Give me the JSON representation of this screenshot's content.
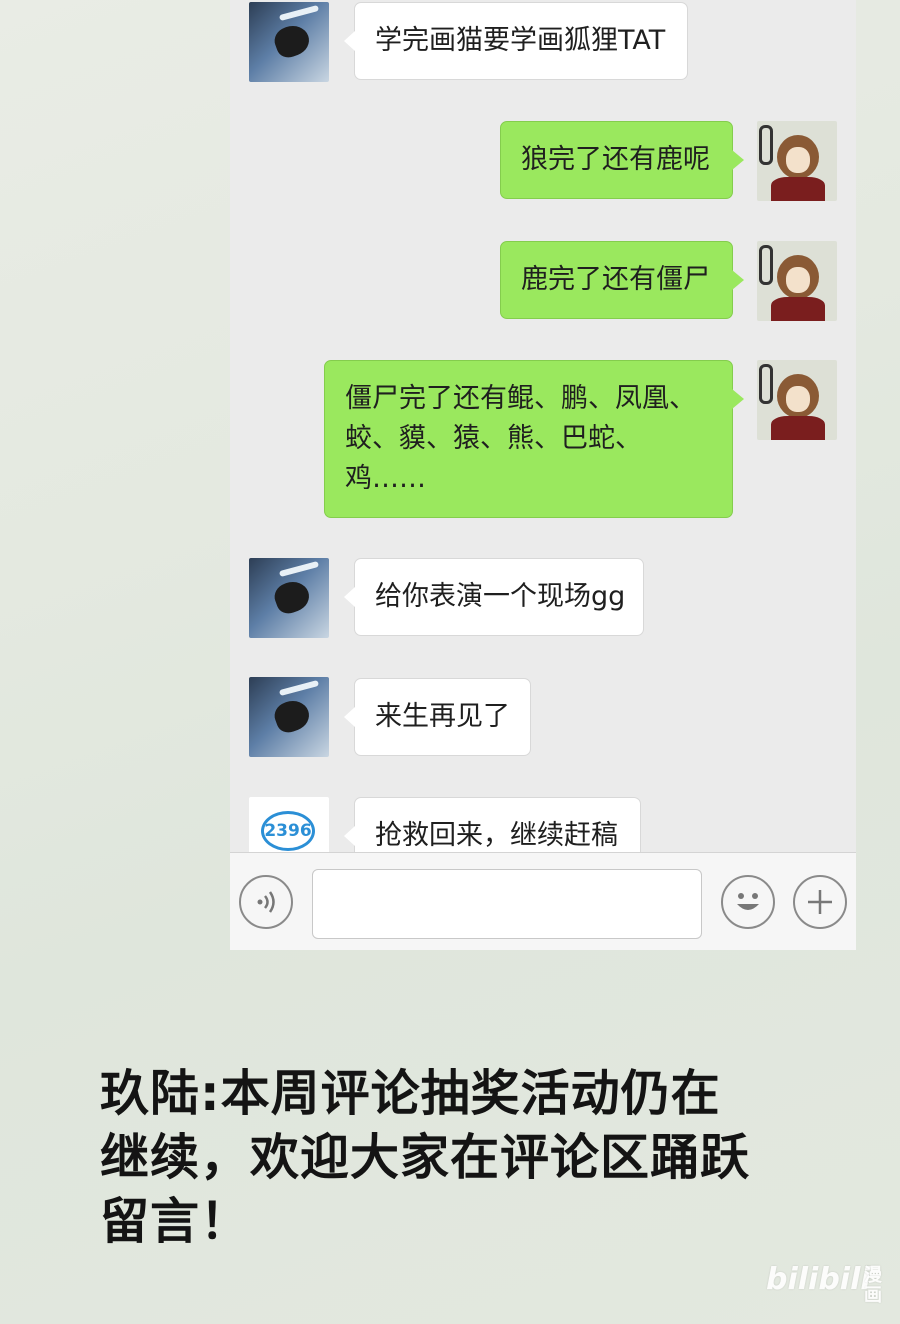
{
  "messages": [
    {
      "side": "left",
      "avatar": "crow-avatar",
      "text": "学完画猫要学画狐狸TAT"
    },
    {
      "side": "right",
      "avatar": "monkey-avatar",
      "text": "狼完了还有鹿呢"
    },
    {
      "side": "right",
      "avatar": "monkey-avatar",
      "text": "鹿完了还有僵尸"
    },
    {
      "side": "right",
      "avatar": "monkey-avatar",
      "lines": [
        "僵尸完了还有鲲、鹏、凤凰、",
        "蛟、貘、猿、熊、巴蛇、",
        "鸡……"
      ]
    },
    {
      "side": "left",
      "avatar": "crow-avatar",
      "text": "给你表演一个现场gg"
    },
    {
      "side": "left",
      "avatar": "crow-avatar",
      "text": "来生再见了"
    },
    {
      "side": "left",
      "avatar": "2396-logo-avatar",
      "avatar_text": "2396",
      "text": "抢救回来，继续赶稿"
    }
  ],
  "input_bar": {
    "voice_icon": "voice-icon",
    "emoji_icon": "emoji-icon",
    "plus_icon": "plus-icon",
    "input_value": ""
  },
  "caption": {
    "lines": [
      "玖陆:本周评论抽奖活动仍在",
      "继续，欢迎大家在评论区踊跃",
      "留言！"
    ]
  },
  "watermark": {
    "logo": "bilibili",
    "tag": "漫画"
  },
  "colors": {
    "sent_bubble": "#9ae85e",
    "received_bubble": "#ffffff",
    "chat_bg": "#ebebeb"
  }
}
